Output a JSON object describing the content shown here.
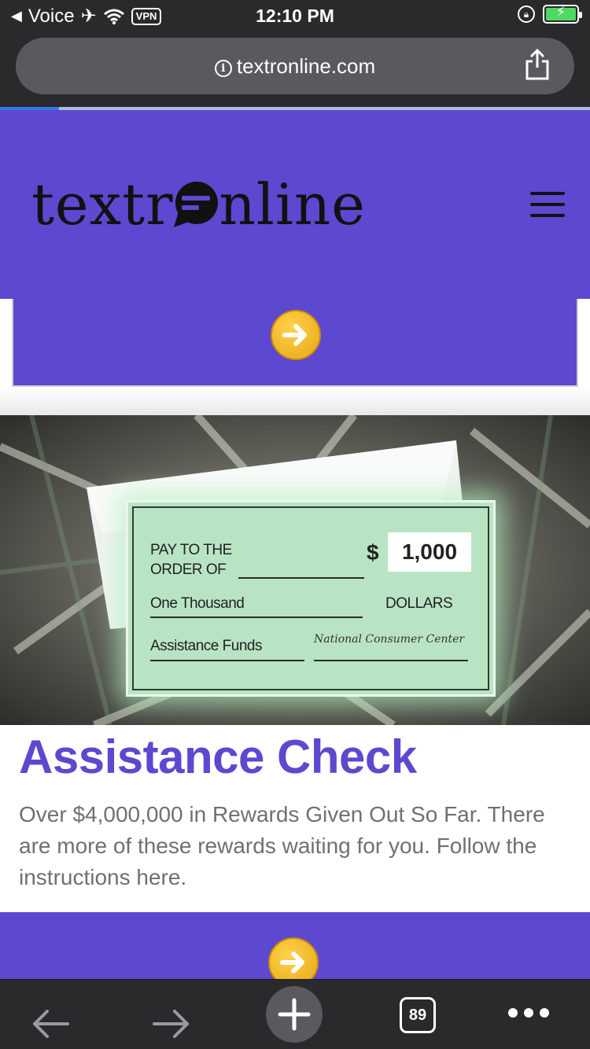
{
  "status_bar": {
    "carrier": "Voice",
    "vpn": "VPN",
    "time": "12:10 PM"
  },
  "browser": {
    "url": "textronline.com",
    "tabs_count": "89",
    "load_progress": 0.1
  },
  "header": {
    "logo_left": "textr",
    "logo_right": "nline"
  },
  "check": {
    "pay_to": "PAY TO THE",
    "order_of": "ORDER OF",
    "dollar_sign": "$",
    "amount": "1,000",
    "amount_words": "One Thousand",
    "dollars": "DOLLARS",
    "memo": "Assistance Funds",
    "signature": "National Consumer Center"
  },
  "article": {
    "title": "Assistance Check",
    "body": "Over $4,000,000 in Rewards Given Out So Far. There are more of these rewards waiting for you. Follow the instructions here."
  },
  "colors": {
    "brand_purple": "#5d48d0",
    "arrow_gold": "#f0b62a"
  }
}
